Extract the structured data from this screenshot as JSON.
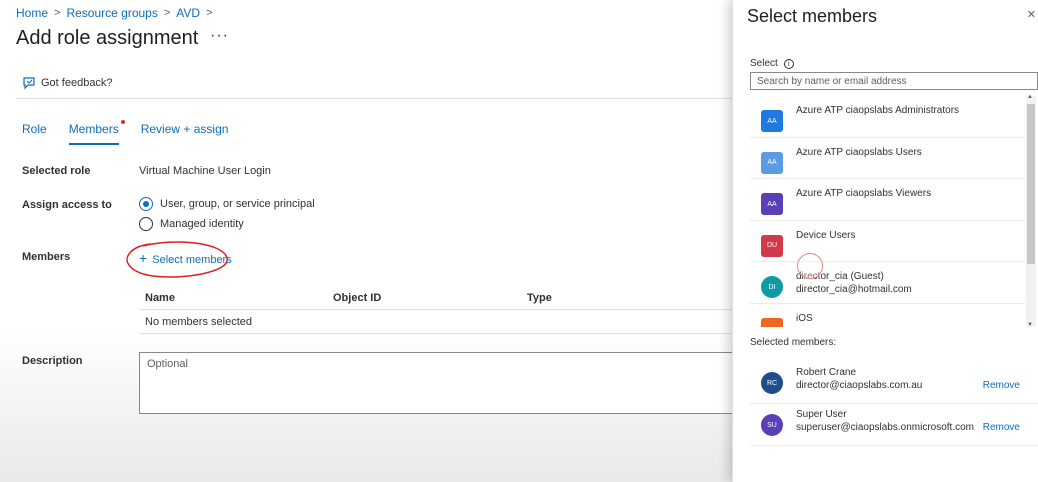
{
  "breadcrumb": {
    "home": "Home",
    "resource_groups": "Resource groups",
    "avd": "AVD",
    "sep": ">"
  },
  "page": {
    "title": "Add role assignment",
    "more": "···"
  },
  "feedback": {
    "label": "Got feedback?",
    "icon": "feedback-icon"
  },
  "tabs": [
    {
      "label": "Role"
    },
    {
      "label": "Members"
    },
    {
      "label": "Review + assign"
    }
  ],
  "form": {
    "selected_role_label": "Selected role",
    "selected_role_value": "Virtual Machine User Login",
    "assign_access_label": "Assign access to",
    "option_user": "User, group, or service principal",
    "option_managed": "Managed identity",
    "members_label": "Members",
    "select_members_plus": "+",
    "select_members": "Select members",
    "description_label": "Description",
    "description_placeholder": "Optional"
  },
  "members_table": {
    "headers": [
      "Name",
      "Object ID",
      "Type"
    ],
    "empty": "No members selected"
  },
  "panel": {
    "title": "Select members",
    "close": "✕",
    "select_label": "Select",
    "info": "i",
    "search_placeholder": "Search by name or email address",
    "list": [
      {
        "initials": "AA",
        "name": "Azure ATP ciaopslabs Administrators",
        "color": "#1f7ae0"
      },
      {
        "initials": "AA",
        "name": "Azure ATP ciaopslabs Users",
        "color": "#5a9be6"
      },
      {
        "initials": "AA",
        "name": "Azure ATP ciaopslabs Viewers",
        "color": "#5b3fb6"
      },
      {
        "initials": "DU",
        "name": "Device Users",
        "color": "#d13a4a"
      },
      {
        "initials": "DI",
        "name": "director_cia (Guest)",
        "email": "director_cia@hotmail.com",
        "color": "#0f9aa6"
      },
      {
        "initials": "",
        "name": "iOS",
        "color": "#e86a1f"
      }
    ],
    "selected_label": "Selected members:",
    "selected": [
      {
        "initials": "RC",
        "name": "Robert Crane",
        "email": "director@ciaopslabs.com.au",
        "color": "#1f4e8c",
        "remove": "Remove"
      },
      {
        "initials": "SU",
        "name": "Super User",
        "email": "superuser@ciaopslabs.onmicrosoft.com",
        "color": "#5b3fb6",
        "remove": "Remove"
      }
    ],
    "scroll_up": "▲",
    "scroll_down": "▼"
  }
}
